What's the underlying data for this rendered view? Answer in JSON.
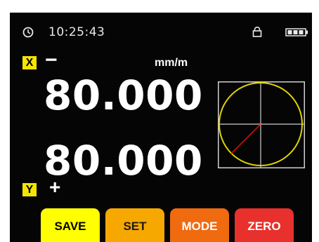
{
  "status_bar": {
    "time": "10:25:43",
    "icons": [
      "clock-icon",
      "lock-icon",
      "battery-icon"
    ]
  },
  "readout": {
    "x": {
      "axis": "X",
      "sign": "−",
      "value": "80.000"
    },
    "y": {
      "axis": "Y",
      "sign": "+",
      "value": "80.000"
    },
    "unit": "mm/m"
  },
  "level_display": {
    "ring_color": "#e0d300",
    "crosshair_color": "#d0d0d0",
    "indicator_color": "#e01010"
  },
  "buttons": [
    {
      "label": "SAVE",
      "color": "#ffff00",
      "text_color": "#000000"
    },
    {
      "label": "SET",
      "color": "#f7a800",
      "text_color": "#1a1a1a"
    },
    {
      "label": "MODE",
      "color": "#f06a10",
      "text_color": "#ffffff"
    },
    {
      "label": "ZERO",
      "color": "#e8302c",
      "text_color": "#ffffff"
    }
  ]
}
